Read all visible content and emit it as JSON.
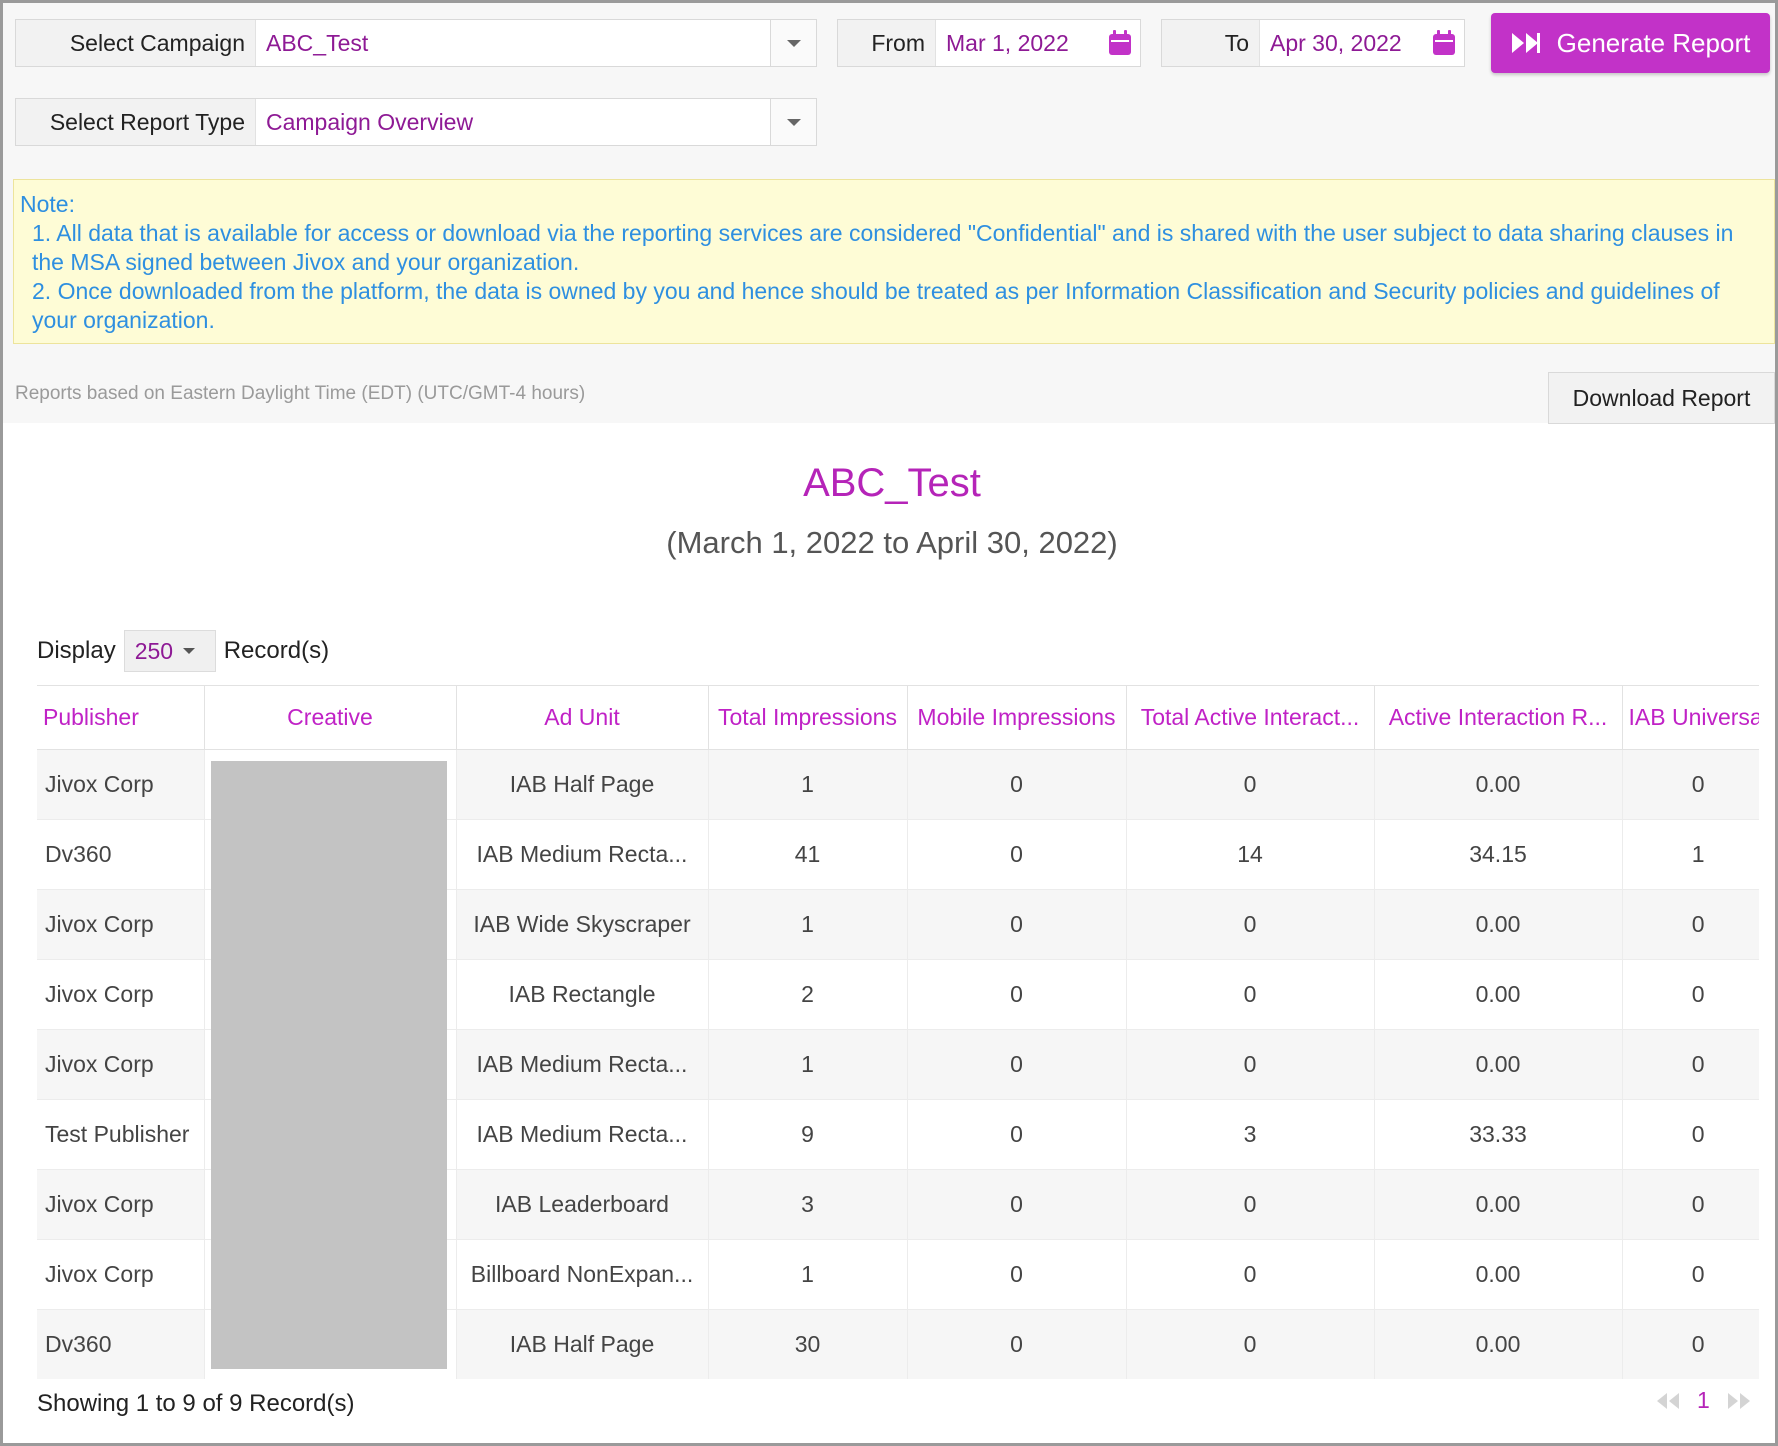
{
  "filters": {
    "campaign_label": "Select Campaign",
    "campaign_value": "ABC_Test",
    "report_type_label": "Select Report Type",
    "report_type_value": "Campaign Overview",
    "from_label": "From",
    "from_value": "Mar 1, 2022",
    "to_label": "To",
    "to_value": "Apr 30, 2022",
    "generate_label": "Generate Report"
  },
  "note": {
    "heading": "Note:",
    "line1": "1. All data that is available for access or download via the reporting services are considered \"Confidential\" and is shared with the user subject to data sharing clauses in the MSA signed between Jivox and your organization.",
    "line2": "2. Once downloaded from the platform, the data is owned by you and hence should be treated as per Information Classification and Security policies and guidelines of your organization."
  },
  "timezone_text": "Reports based on Eastern Daylight Time (EDT) (UTC/GMT-4 hours)",
  "download_label": "Download Report",
  "report": {
    "title": "ABC_Test",
    "subtitle": "(March 1, 2022 to April 30, 2022)"
  },
  "display": {
    "prefix": "Display",
    "count": "250",
    "suffix": "Record(s)"
  },
  "table": {
    "headers": [
      "Publisher",
      "Creative",
      "Ad Unit",
      "Total Impressions",
      "Mobile Impressions",
      "Total Active Interact...",
      "Active Interaction R...",
      "IAB Universal"
    ],
    "rows": [
      [
        "Jivox Corp",
        "",
        "IAB Half Page",
        "1",
        "0",
        "0",
        "0.00",
        "0"
      ],
      [
        "Dv360",
        "",
        "IAB Medium Recta...",
        "41",
        "0",
        "14",
        "34.15",
        "1"
      ],
      [
        "Jivox Corp",
        "",
        "IAB Wide Skyscraper",
        "1",
        "0",
        "0",
        "0.00",
        "0"
      ],
      [
        "Jivox Corp",
        "",
        "IAB Rectangle",
        "2",
        "0",
        "0",
        "0.00",
        "0"
      ],
      [
        "Jivox Corp",
        "",
        "IAB Medium Recta...",
        "1",
        "0",
        "0",
        "0.00",
        "0"
      ],
      [
        "Test Publisher",
        "",
        "IAB Medium Recta...",
        "9",
        "0",
        "3",
        "33.33",
        "0"
      ],
      [
        "Jivox Corp",
        "",
        "IAB Leaderboard",
        "3",
        "0",
        "0",
        "0.00",
        "0"
      ],
      [
        "Jivox Corp",
        "",
        "Billboard NonExpan...",
        "1",
        "0",
        "0",
        "0.00",
        "0"
      ],
      [
        "Dv360",
        "",
        "IAB Half Page",
        "30",
        "0",
        "0",
        "0.00",
        "0"
      ]
    ]
  },
  "footer": {
    "showing": "Showing 1 to 9 of 9 Record(s)",
    "page": "1"
  },
  "colors": {
    "accent": "#c232c8",
    "value_text": "#8e1a95",
    "note_text": "#2e8fe0",
    "note_bg": "#fefcd6"
  }
}
